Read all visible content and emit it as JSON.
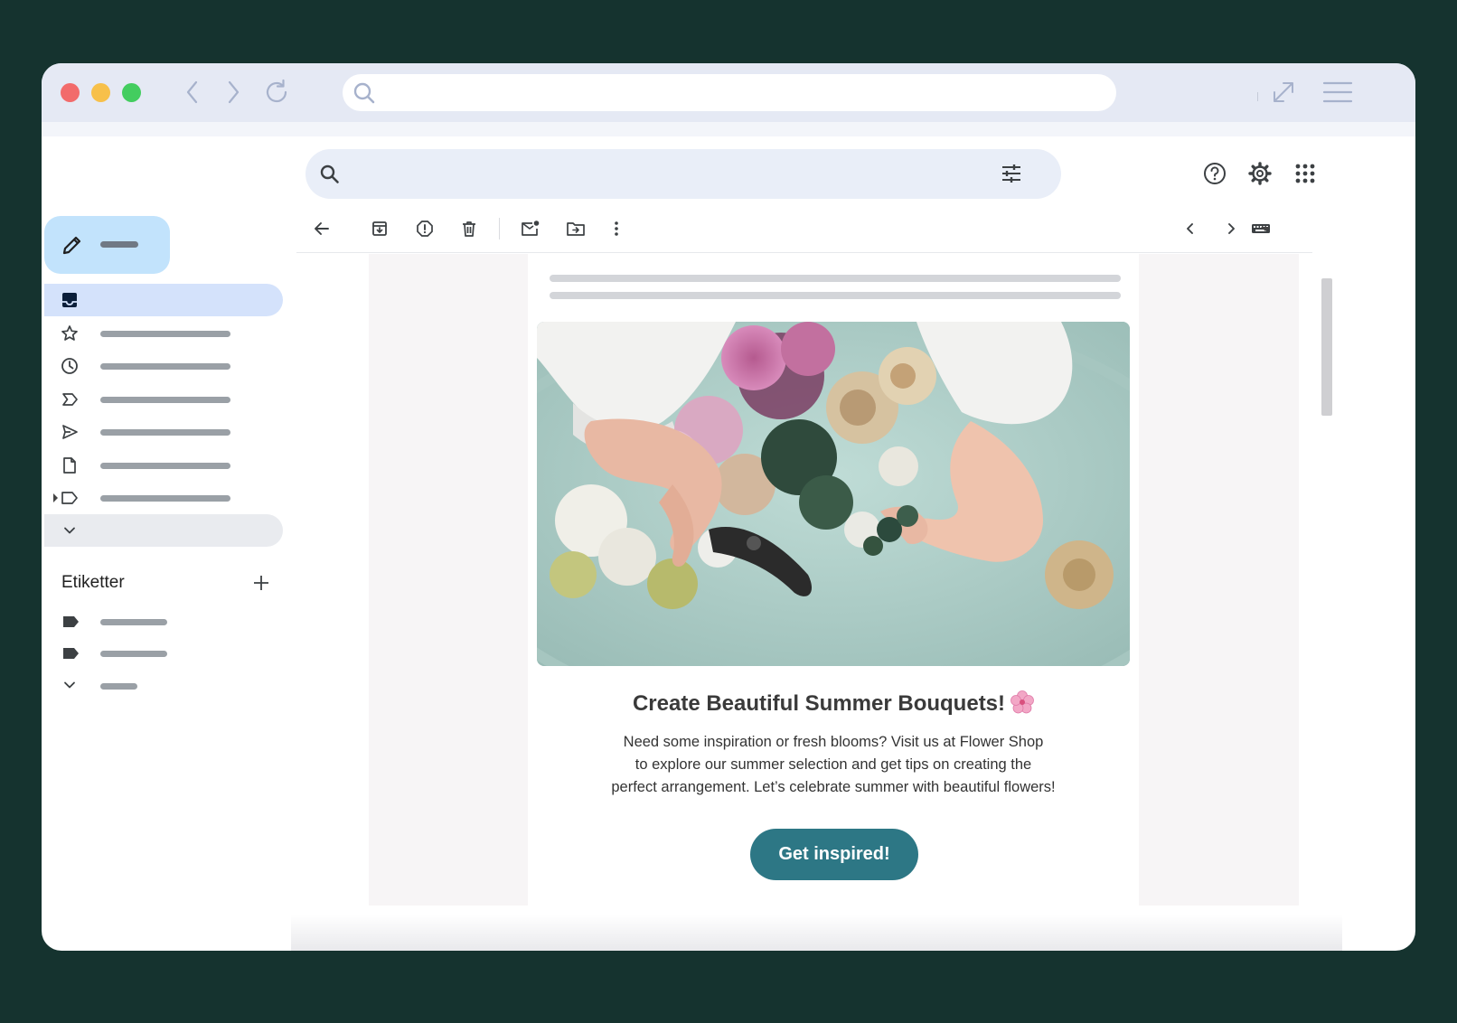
{
  "browser": {
    "url_value": "",
    "icons": [
      "back-icon",
      "forward-icon",
      "reload-icon",
      "search-icon",
      "expand-icon",
      "menu-icon"
    ]
  },
  "gmail": {
    "search_value": "",
    "top_icons": [
      "help-icon",
      "settings-icon",
      "apps-icon"
    ],
    "sidebar": {
      "nav_icons": [
        "inbox-icon",
        "star-icon",
        "clock-icon",
        "important-icon",
        "send-icon",
        "draft-icon",
        "label-outline-icon",
        "chevron-down-icon"
      ],
      "labels_heading": "Etiketter"
    },
    "toolbar_icons": [
      "back-arrow-icon",
      "archive-icon",
      "spam-icon",
      "trash-icon",
      "mark-unread-icon",
      "move-to-icon",
      "more-vert-icon",
      "prev-icon",
      "next-icon",
      "keyboard-icon"
    ]
  },
  "email": {
    "title": "Create Beautiful Summer Bouquets!",
    "title_emoji": "🌸",
    "body_line1": "Need some inspiration or fresh blooms? Visit us at Flower Shop",
    "body_line2": "to explore our summer selection and get tips on creating the",
    "body_line3": "perfect arrangement. Let’s celebrate summer with beautiful flowers!",
    "cta_label": "Get inspired!"
  },
  "colors": {
    "background": "#15332f",
    "chrome": "#e5e9f4",
    "compose": "#c2e3fc",
    "active_nav": "#d4e2fb",
    "cta": "#2d7785"
  }
}
